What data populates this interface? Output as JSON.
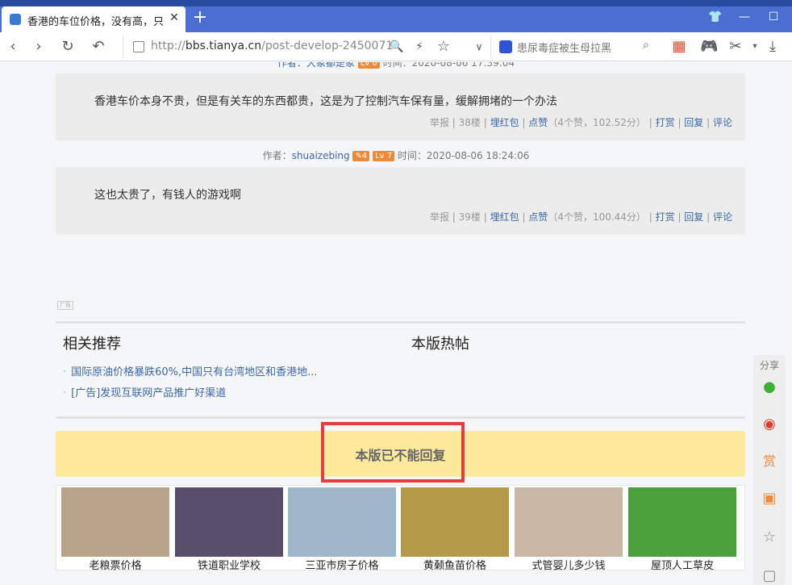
{
  "browser": {
    "tab_title": "香港的车位价格，没有高，只有",
    "url_prefix": "http://",
    "url_host": "bbs.tianya.cn",
    "url_path": "/post-develop-2450071",
    "search_placeholder": "患尿毒症被生母拉黑"
  },
  "posts": [
    {
      "author_partial": "作者：大象都是象",
      "time_partial": "时间：2020-08-06 17:39:04",
      "body": "香港车价本身不贵，但是有关车的东西都贵，这是为了控制汽车保有量，缓解拥堵的一个办法",
      "report": "举报",
      "floor": "38楼",
      "hongbao": "埋红包",
      "like": "点赞",
      "like_stats": "（4个赞，102.52分）",
      "reward": "打赏",
      "reply": "回复",
      "comment": "评论"
    },
    {
      "author_label": "作者：",
      "author": "shuaizebing",
      "badge_num": "4",
      "level": "Lv 7",
      "time": "时间：2020-08-06 18:24:06",
      "body": "这也太贵了，有钱人的游戏啊",
      "report": "举报",
      "floor": "39楼",
      "hongbao": "埋红包",
      "like": "点赞",
      "like_stats": "（4个赞，100.44分）",
      "reward": "打赏",
      "reply": "回复",
      "comment": "评论"
    }
  ],
  "ad_tag": "广告",
  "related": {
    "title": "相关推荐",
    "items": [
      "国际原油价格暴跌60%,中国只有台湾地区和香港地...",
      "[广告]发现互联网产品推广好渠道"
    ]
  },
  "hot": {
    "title": "本版热帖"
  },
  "no_reply": "本版已不能回复",
  "ads": [
    {
      "caption": "老粮票价格",
      "color": "#b8a48a"
    },
    {
      "caption": "铁道职业学校",
      "color": "#5a4f6a"
    },
    {
      "caption": "三亚市房子价格",
      "color": "#9fb8c9"
    },
    {
      "caption": "黄颡鱼苗价格",
      "color": "#b59a4a"
    },
    {
      "caption": "式管婴儿多少钱",
      "color": "#c9b7a6"
    },
    {
      "caption": "屋顶人工草皮",
      "color": "#4aa03a"
    }
  ],
  "sidebar": {
    "share": "分享"
  }
}
